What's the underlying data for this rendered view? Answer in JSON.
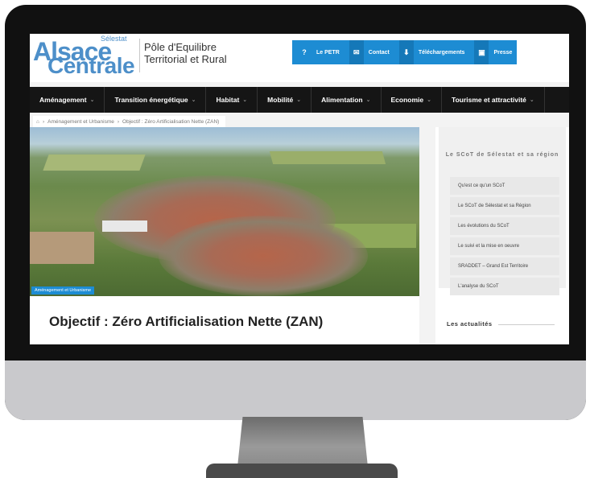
{
  "header": {
    "logo_small": "Sélestat",
    "logo_line1": "Alsace",
    "logo_line2": "Centrale",
    "org_line1": "Pôle d'Equilibre",
    "org_line2": "Territorial et Rural"
  },
  "topnav": [
    {
      "icon": "?",
      "label": "Le PETR"
    },
    {
      "icon": "✉",
      "label": "Contact"
    },
    {
      "icon": "⬇",
      "label": "Téléchargements"
    },
    {
      "icon": "▣",
      "label": "Presse"
    }
  ],
  "mainnav": [
    {
      "label": "Aménagement"
    },
    {
      "label": "Transition énergétique"
    },
    {
      "label": "Habitat"
    },
    {
      "label": "Mobilité"
    },
    {
      "label": "Alimentation"
    },
    {
      "label": "Economie"
    },
    {
      "label": "Tourisme et attractivité"
    }
  ],
  "breadcrumb": {
    "home_icon": "⌂",
    "item1": "Aménagement et Urbanisme",
    "item2": "Objectif : Zéro Artificialisation Nette (ZAN)"
  },
  "hero": {
    "tag": "Aménagement et Urbanisme"
  },
  "article": {
    "title": "Objectif : Zéro Artificialisation Nette (ZAN)"
  },
  "sidebar": {
    "heading": "Le SCoT de Sélestat et sa région",
    "items": [
      "Qu'est ce qu'un SCoT",
      "Le SCoT de Sélestat et sa Région",
      "Les évolutions du SCoT",
      "Le suivi et la mise en oeuvre",
      "SRADDET – Grand Est Territoire",
      "L'analyse du SCoT"
    ],
    "news_heading": "Les actualités"
  },
  "colors": {
    "accent": "#1d8cd3",
    "logo": "#4d8fc9",
    "nav": "#151515"
  }
}
